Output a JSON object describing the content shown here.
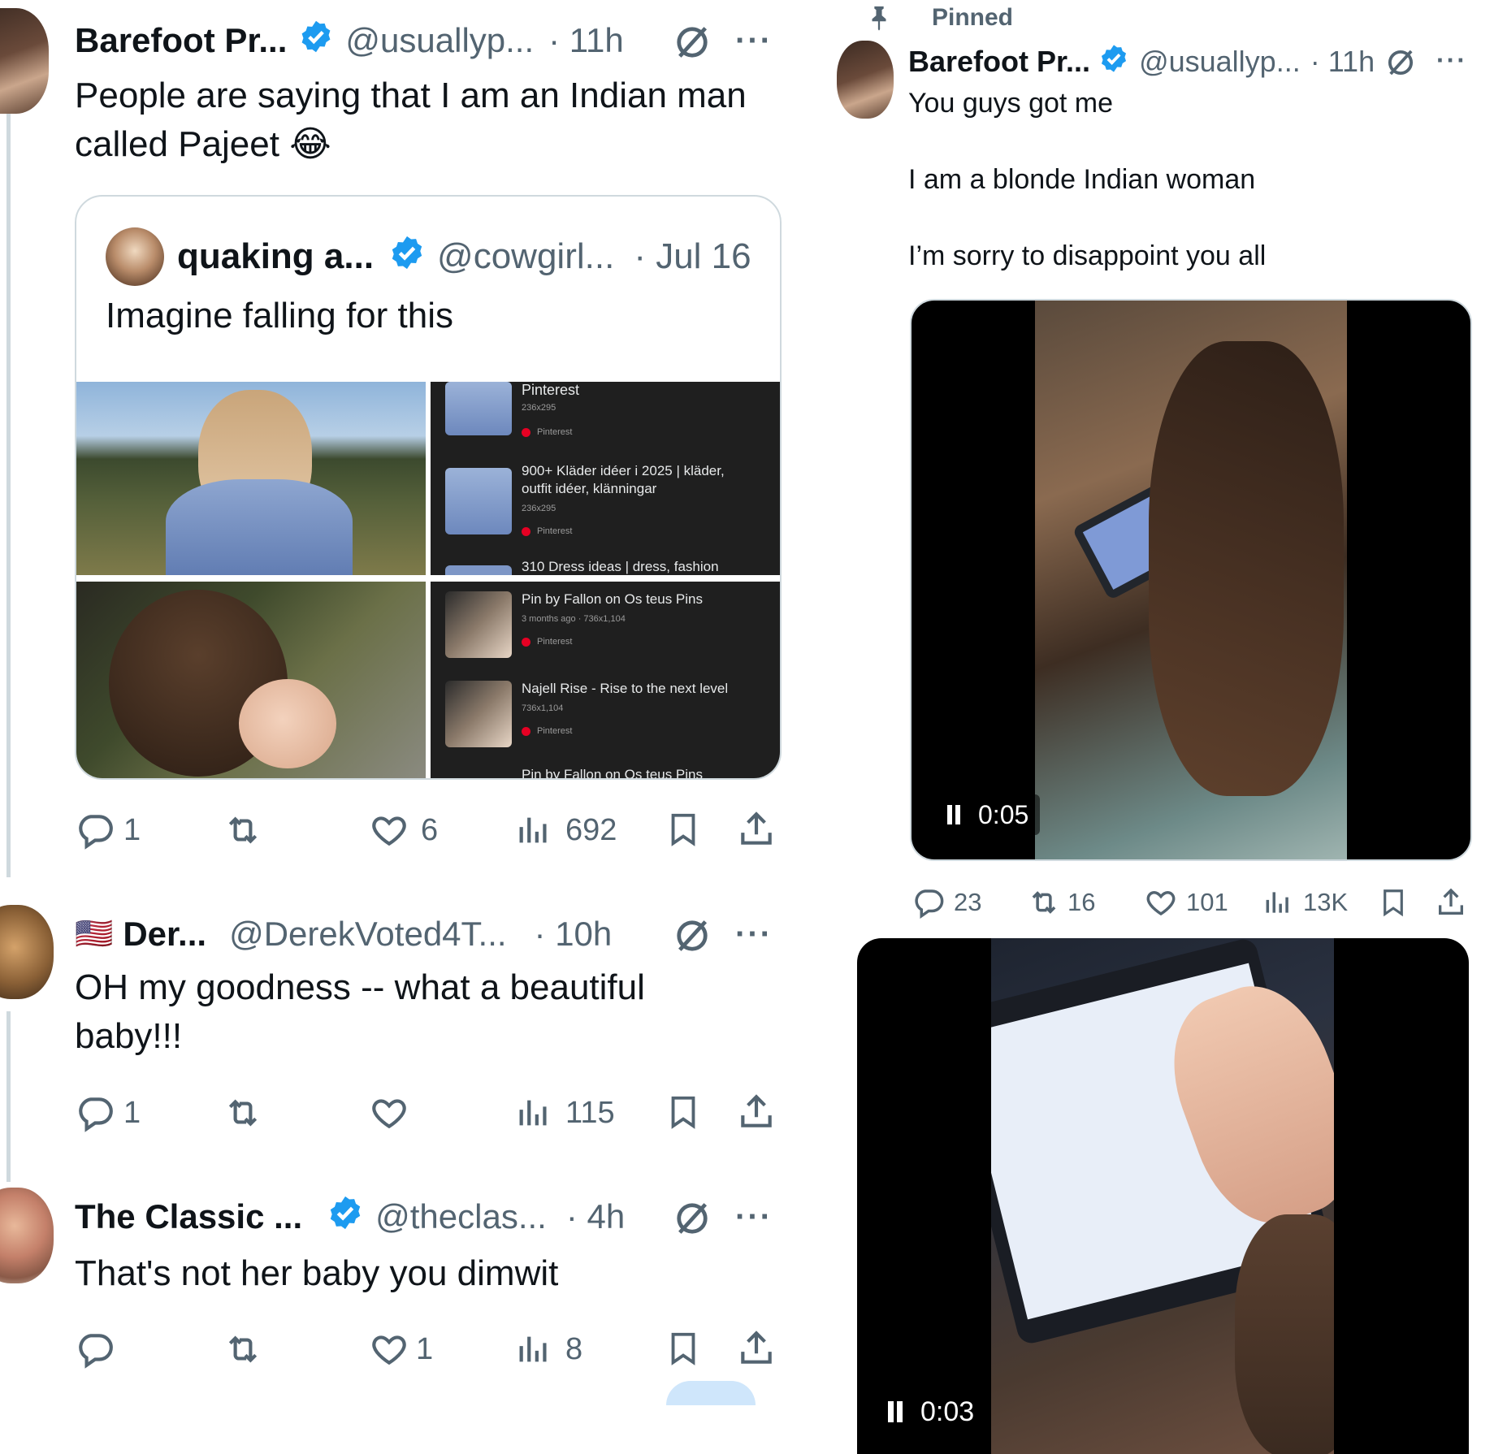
{
  "left": {
    "tweet1": {
      "name": "Barefoot Pr...",
      "handle": "@usuallyp...",
      "time": "· 11h",
      "text_line1": "People are saying that I am an Indian man",
      "text_line2": "called Pajeet",
      "emoji": "😂",
      "quote": {
        "name": "quaking a...",
        "handle": "@cowgirl...",
        "time": "· Jul 16",
        "text": "Imagine falling for this",
        "results_top": [
          {
            "title": "Pinterest",
            "size": "236x295",
            "source": "Pinterest"
          },
          {
            "title": "900+ Kläder idéer i 2025 | kläder,",
            "title2": "outfit idéer, klänningar",
            "size": "236x295",
            "source": "Pinterest"
          },
          {
            "title": "310 Dress ideas | dress, fashion"
          }
        ],
        "results_bottom": [
          {
            "title": "Pin by Fallon on Os teus Pins",
            "size": "3 months ago · 736x1,104",
            "source": "Pinterest"
          },
          {
            "title": "Najell Rise - Rise to the next level",
            "size": "736x1,104",
            "source": "Pinterest"
          },
          {
            "title": "Pin by Fallon on Os teus Pins"
          }
        ]
      },
      "stats": {
        "replies": "1",
        "retweets": "",
        "likes": "6",
        "views": "692"
      }
    },
    "tweet2": {
      "flag": "🇺🇸",
      "name": "Der...",
      "handle": "@DerekVoted4T...",
      "time": "· 10h",
      "text_line1": "OH my goodness -- what a beautiful",
      "text_line2": "baby!!!",
      "stats": {
        "replies": "1",
        "retweets": "",
        "likes": "",
        "views": "115"
      }
    },
    "tweet3": {
      "name": "The Classic ...",
      "handle": "@theclas...",
      "time": "· 4h",
      "text": "That's not her baby you dimwit",
      "stats": {
        "replies": "",
        "retweets": "",
        "likes": "1",
        "views": "8"
      }
    }
  },
  "right": {
    "pinned_label": "Pinned",
    "tweet": {
      "name": "Barefoot Pr...",
      "handle": "@usuallyp...",
      "time": "· 11h",
      "line1": "You guys got me",
      "line2": "I am a blonde Indian woman",
      "line3": "I’m sorry to disappoint you all",
      "video1_time": "0:05",
      "stats": {
        "replies": "23",
        "retweets": "16",
        "likes": "101",
        "views": "13K"
      },
      "video2_time": "0:03"
    }
  },
  "colors": {
    "verified": "#1d9bf0",
    "muted": "#536471",
    "text": "#0f1419",
    "pinterest_red": "#e60023"
  }
}
